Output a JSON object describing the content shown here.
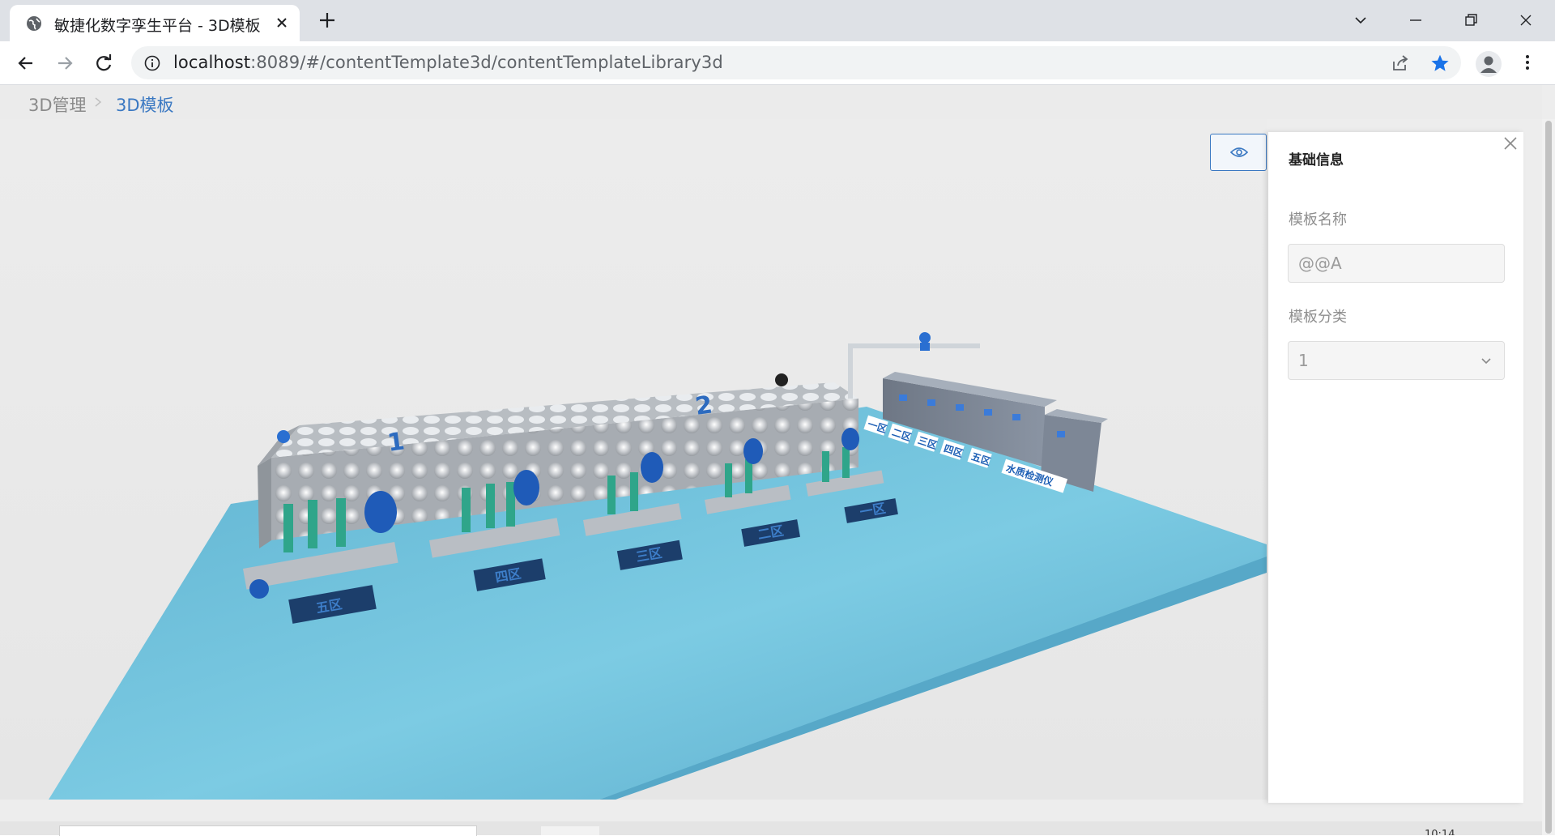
{
  "browser": {
    "tab_title": "敏捷化数字孪生平台 - 3D模板",
    "url_host": "localhost",
    "url_rest": ":8089/#/contentTemplate3d/contentTemplateLibrary3d"
  },
  "breadcrumb": {
    "parent": "3D管理",
    "current": "3D模板"
  },
  "scene": {
    "tank_labels": [
      "1",
      "2"
    ],
    "zone_labels": [
      "五区",
      "四区",
      "三区",
      "二区",
      "一区"
    ],
    "panel_labels": [
      "一区",
      "二区",
      "三区",
      "四区",
      "五区",
      "水质检测仪"
    ]
  },
  "panel": {
    "title": "基础信息",
    "name_label": "模板名称",
    "name_value": "@@A",
    "category_label": "模板分类",
    "category_value": "1"
  },
  "footer": {
    "time_text": "10:14"
  },
  "colors": {
    "accent": "#3a78c2",
    "floor": "#6bbcd8",
    "pump_green": "#2fa58a",
    "pump_blue": "#1f5bb8"
  }
}
